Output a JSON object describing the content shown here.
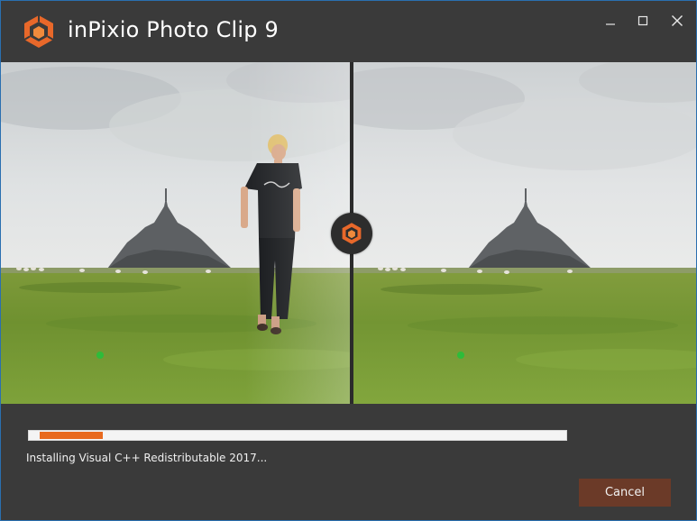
{
  "window": {
    "title": "inPixio Photo Clip 9",
    "controls": {
      "minimize_icon": "minimize-icon",
      "maximize_icon": "maximize-icon",
      "close_icon": "close-icon"
    }
  },
  "colors": {
    "accent": "#e86a1f",
    "cancel_bg": "#6b3a28",
    "background": "#3a3a3a"
  },
  "photo": {
    "left_label": "",
    "right_label": ""
  },
  "installer": {
    "progress_fraction": 0.12,
    "status_text": "Installing Visual C++ Redistributable 2017...",
    "cancel_label": "Cancel"
  }
}
